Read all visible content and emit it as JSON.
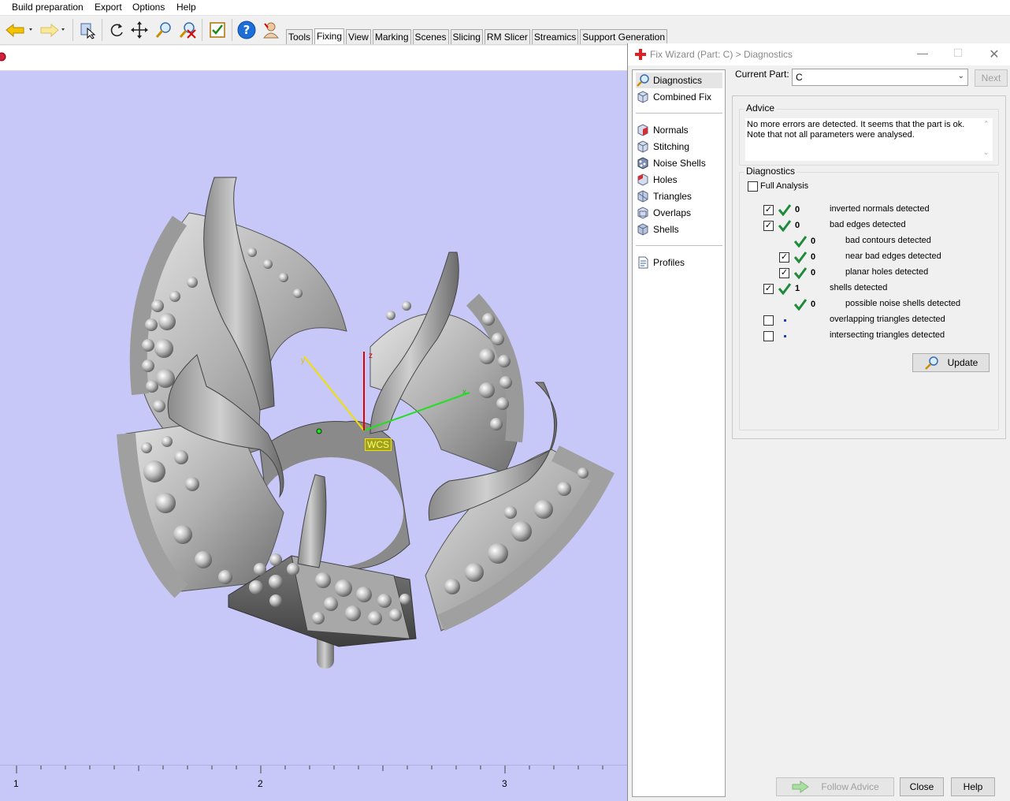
{
  "menu": [
    "Build preparation",
    "Export",
    "Options",
    "Help"
  ],
  "tabs": [
    "Tools",
    "Fixing",
    "View",
    "Marking",
    "Scenes",
    "Slicing",
    "RM Slicer",
    "Streamics",
    "Support Generation"
  ],
  "active_tab": "Fixing",
  "viewport": {
    "wcs_label": "WCS",
    "axis_x_label": "x",
    "axis_y_label": "y",
    "axis_z_label": "z",
    "ruler_ticks": [
      "1",
      "2",
      "3"
    ],
    "background_color": "#c8c8f8"
  },
  "dialog": {
    "title": "Fix Wizard (Part: C) > Diagnostics",
    "nav": {
      "top": [
        "Diagnostics",
        "Combined Fix"
      ],
      "tools": [
        "Normals",
        "Stitching",
        "Noise Shells",
        "Holes",
        "Triangles",
        "Overlaps",
        "Shells"
      ],
      "bottom": [
        "Profiles"
      ]
    },
    "current_part_label": "Current Part:",
    "current_part_value": "C",
    "next_label": "Next",
    "advice_title": "Advice",
    "advice_text": "No more errors are detected. It seems that the part is ok. Note that not all parameters were analysed.",
    "diagnostics_title": "Diagnostics",
    "full_analysis_label": "Full Analysis",
    "full_analysis_checked": false,
    "rows": [
      {
        "checked": true,
        "status": "ok",
        "count": "0",
        "label": "inverted normals detected",
        "indent": false,
        "has_checkbox": true
      },
      {
        "checked": true,
        "status": "ok",
        "count": "0",
        "label": "bad edges detected",
        "indent": false,
        "has_checkbox": true
      },
      {
        "checked": false,
        "status": "ok",
        "count": "0",
        "label": "bad contours detected",
        "indent": true,
        "has_checkbox": false
      },
      {
        "checked": true,
        "status": "ok",
        "count": "0",
        "label": "near bad edges detected",
        "indent": true,
        "has_checkbox": true
      },
      {
        "checked": true,
        "status": "ok",
        "count": "0",
        "label": "planar holes detected",
        "indent": true,
        "has_checkbox": true
      },
      {
        "checked": true,
        "status": "ok",
        "count": "1",
        "label": "shells detected",
        "indent": false,
        "has_checkbox": true
      },
      {
        "checked": false,
        "status": "ok",
        "count": "0",
        "label": "possible noise shells detected",
        "indent": true,
        "has_checkbox": false
      },
      {
        "checked": false,
        "status": "none",
        "count": "",
        "label": "overlapping triangles detected",
        "indent": false,
        "has_checkbox": true
      },
      {
        "checked": false,
        "status": "none",
        "count": "",
        "label": "intersecting triangles detected",
        "indent": false,
        "has_checkbox": true
      }
    ],
    "update_label": "Update",
    "follow_advice_label": "Follow Advice",
    "close_label": "Close",
    "help_label": "Help"
  }
}
